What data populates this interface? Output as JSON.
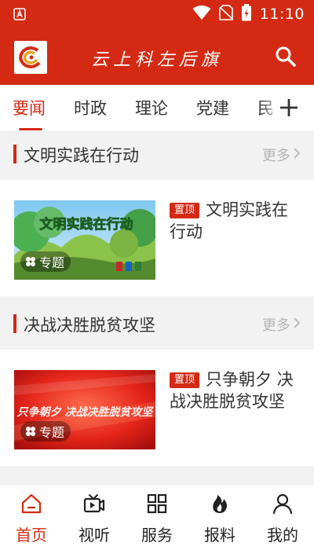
{
  "status_bar": {
    "time": "11:10"
  },
  "header": {
    "title": "云上科左后旗",
    "brand_color": "#d42a14"
  },
  "tabs": [
    {
      "label": "要闻",
      "active": true
    },
    {
      "label": "时政",
      "active": false
    },
    {
      "label": "理论",
      "active": false
    },
    {
      "label": "党建",
      "active": false
    },
    {
      "label": "民",
      "active": false
    }
  ],
  "sections": [
    {
      "title": "文明实践在行动",
      "more": "更多",
      "card": {
        "pin": "置顶",
        "title": "文明实践在行动",
        "badge": "专题",
        "image_text": "文明实践在行动"
      }
    },
    {
      "title": "决战决胜脱贫攻坚",
      "more": "更多",
      "card": {
        "pin": "置顶",
        "title": "只争朝夕 决战决胜脱贫攻坚",
        "badge": "专题",
        "image_text": "只争朝夕 决战决胜脱贫攻坚"
      }
    }
  ],
  "bottom_nav": [
    {
      "label": "首页",
      "icon": "home-icon",
      "active": true
    },
    {
      "label": "视听",
      "icon": "video-icon",
      "active": false
    },
    {
      "label": "服务",
      "icon": "grid-icon",
      "active": false
    },
    {
      "label": "报料",
      "icon": "flame-icon",
      "active": false
    },
    {
      "label": "我的",
      "icon": "user-icon",
      "active": false
    }
  ]
}
